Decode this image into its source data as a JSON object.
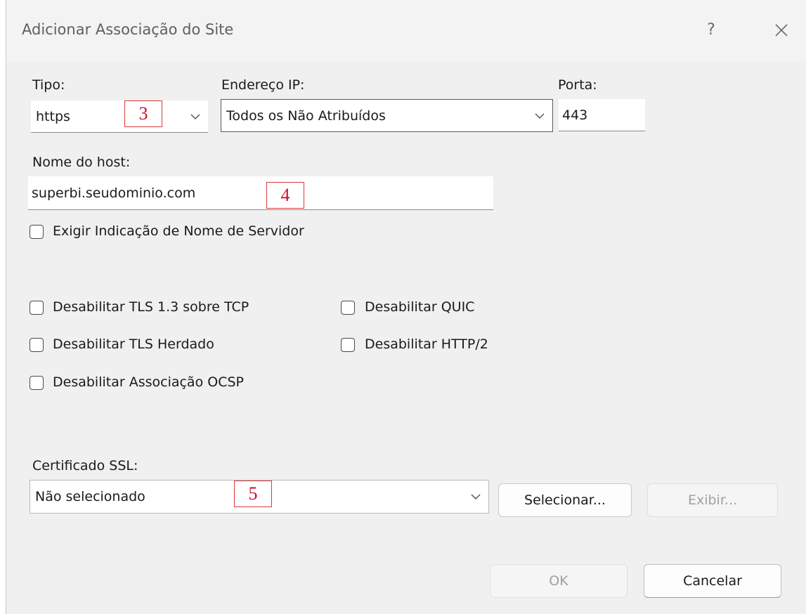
{
  "window": {
    "title": "Adicionar Associação do Site",
    "help_label": "?"
  },
  "fields": {
    "tipo": {
      "label": "Tipo:",
      "value": "https"
    },
    "endereco_ip": {
      "label": "Endereço IP:",
      "value": "Todos os Não Atribuídos"
    },
    "porta": {
      "label": "Porta:",
      "value": "443"
    },
    "hostname": {
      "label": "Nome do host:",
      "value": "superbi.seudominio.com"
    },
    "certificado": {
      "label": "Certificado SSL:",
      "value": "Não selecionado"
    }
  },
  "checkboxes": {
    "sni": {
      "label": "Exigir Indicação de Nome de Servidor",
      "checked": false
    },
    "tls13": {
      "label": "Desabilitar TLS 1.3 sobre TCP",
      "checked": false
    },
    "tls_legacy": {
      "label": "Desabilitar TLS Herdado",
      "checked": false
    },
    "ocsp": {
      "label": "Desabilitar Associação OCSP",
      "checked": false
    },
    "quic": {
      "label": "Desabilitar QUIC",
      "checked": false
    },
    "http2": {
      "label": "Desabilitar HTTP/2",
      "checked": false
    }
  },
  "buttons": {
    "selecionar": "Selecionar...",
    "exibir": "Exibir...",
    "ok": "OK",
    "cancelar": "Cancelar"
  },
  "annotations": {
    "m3": "3",
    "m4": "4",
    "m5": "5"
  },
  "colors": {
    "annotation": "#c8102e",
    "dialog_bg": "#f0f0f0"
  },
  "icons": [
    "close-icon",
    "chevron-down-icon",
    "checkbox-icon"
  ]
}
